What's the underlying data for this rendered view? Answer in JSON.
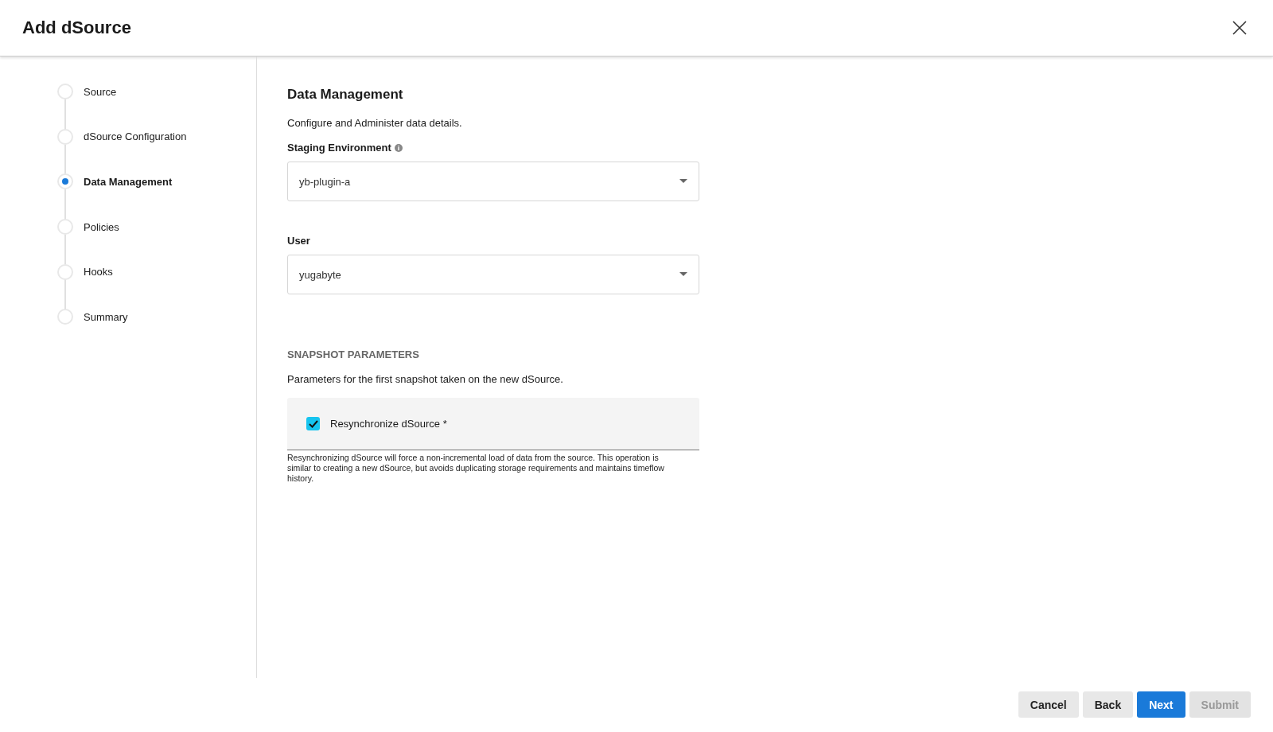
{
  "window": {
    "title": "Add dSource"
  },
  "steps": [
    {
      "label": "Source",
      "selected": false
    },
    {
      "label": "dSource Configuration",
      "selected": false
    },
    {
      "label": "Data Management",
      "selected": true
    },
    {
      "label": "Policies",
      "selected": false
    },
    {
      "label": "Hooks",
      "selected": false
    },
    {
      "label": "Summary",
      "selected": false
    }
  ],
  "section": {
    "title": "Data Management",
    "description": "Configure and Administer data details."
  },
  "fields": [
    {
      "label": "Staging Environment",
      "info": true,
      "value": "yb-plugin-a"
    },
    {
      "label": "User",
      "info": false,
      "value": "yugabyte"
    }
  ],
  "snapshot": {
    "heading": "SNAPSHOT PARAMETERS",
    "description": "Parameters for the first snapshot taken on the new dSource.",
    "checkbox": {
      "label": "Resynchronize dSource *",
      "checked": true
    },
    "help": "Resynchronizing dSource will force a non-incremental load of data from the source. This operation is similar to creating a new dSource, but avoids duplicating storage requirements and maintains timeflow history."
  },
  "buttons": [
    {
      "label": "Cancel",
      "kind": "secondary",
      "disabled": false
    },
    {
      "label": "Back",
      "kind": "secondary",
      "disabled": false
    },
    {
      "label": "Next",
      "kind": "primary",
      "disabled": false
    },
    {
      "label": "Submit",
      "kind": "secondary",
      "disabled": true
    }
  ]
}
